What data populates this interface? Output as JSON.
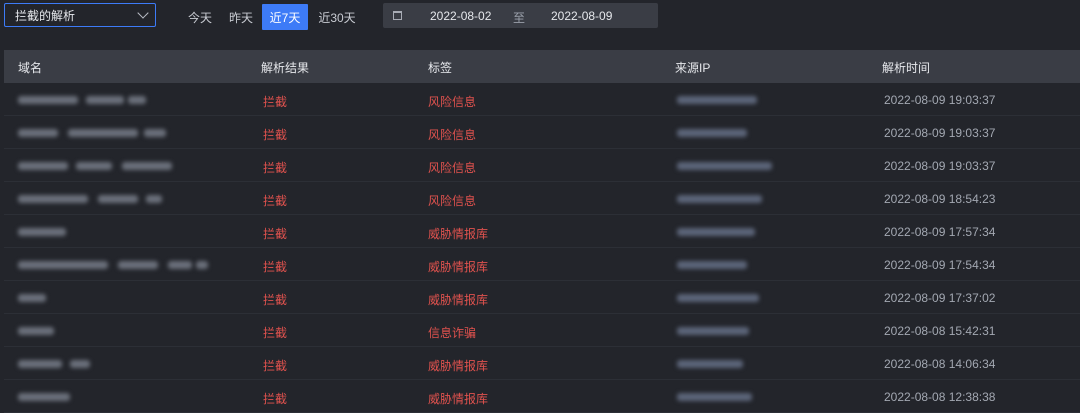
{
  "filter": {
    "selected": "拦截的解析"
  },
  "quick_ranges": [
    "今天",
    "昨天",
    "近7天",
    "近30天"
  ],
  "active_range": "近7天",
  "date_range": {
    "start": "2022-08-02",
    "separator": "至",
    "end": "2022-08-09"
  },
  "table": {
    "columns": [
      "域名",
      "解析结果",
      "标签",
      "来源IP",
      "解析时间"
    ],
    "rows": [
      {
        "result": "拦截",
        "tag": "风险信息",
        "time": "2022-08-09 19:03:37"
      },
      {
        "result": "拦截",
        "tag": "风险信息",
        "time": "2022-08-09 19:03:37"
      },
      {
        "result": "拦截",
        "tag": "风险信息",
        "time": "2022-08-09 19:03:37"
      },
      {
        "result": "拦截",
        "tag": "风险信息",
        "time": "2022-08-09 18:54:23"
      },
      {
        "result": "拦截",
        "tag": "威胁情报库",
        "time": "2022-08-09 17:57:34"
      },
      {
        "result": "拦截",
        "tag": "威胁情报库",
        "time": "2022-08-09 17:54:34"
      },
      {
        "result": "拦截",
        "tag": "威胁情报库",
        "time": "2022-08-09 17:37:02"
      },
      {
        "result": "拦截",
        "tag": "信息诈骗",
        "time": "2022-08-08 15:42:31"
      },
      {
        "result": "拦截",
        "tag": "威胁情报库",
        "time": "2022-08-08 14:06:34"
      },
      {
        "result": "拦截",
        "tag": "威胁情报库",
        "time": "2022-08-08 12:38:38"
      }
    ]
  },
  "colors": {
    "accent": "#3d7bf7",
    "blocked": "#e0524e",
    "background": "#23252b",
    "header_bg": "#3a3d45"
  }
}
